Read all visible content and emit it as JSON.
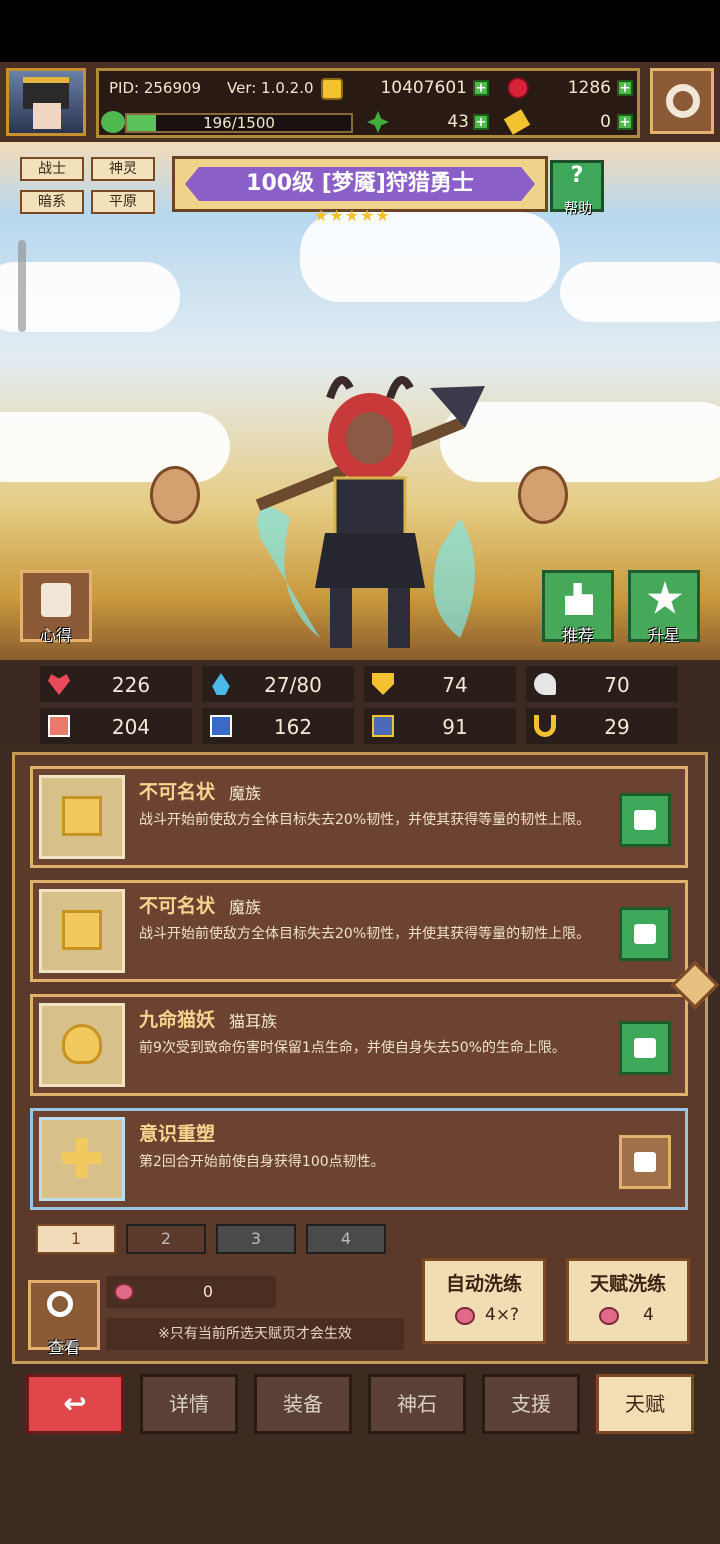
{
  "header": {
    "pid": "PID: 256909",
    "ver": "Ver: 1.0.2.0",
    "gold": "10407601",
    "gems": "1286",
    "exp": "196/1500",
    "clover": "43",
    "key": "0"
  },
  "hero": {
    "tags": [
      "战士",
      "神灵",
      "暗系",
      "平原"
    ],
    "name": "100级  [梦魇]狩猎勇士",
    "stars": "★★★★★",
    "help": "帮助"
  },
  "scene_buttons": {
    "insight": "心得",
    "recommend": "推荐",
    "upstar": "升星"
  },
  "stats": [
    {
      "icon": "heart-icon",
      "value": "226"
    },
    {
      "icon": "mana-drop-icon",
      "value": "27/80"
    },
    {
      "icon": "shield-icon",
      "value": "74"
    },
    {
      "icon": "wing-icon",
      "value": "70"
    },
    {
      "icon": "fist-icon",
      "value": "204"
    },
    {
      "icon": "book-icon",
      "value": "162"
    },
    {
      "icon": "armor-icon",
      "value": "91"
    },
    {
      "icon": "horseshoe-icon",
      "value": "29"
    }
  ],
  "talents": [
    {
      "name": "不可名状",
      "race": "魔族",
      "desc": "战斗开始前使敌方全体目标失去20%韧性，并使其获得等量的韧性上限。"
    },
    {
      "name": "不可名状",
      "race": "魔族",
      "desc": "战斗开始前使敌方全体目标失去20%韧性，并使其获得等量的韧性上限。"
    },
    {
      "name": "九命猫妖",
      "race": "猫耳族",
      "desc": "前9次受到致命伤害时保留1点生命，并使自身失去50%的生命上限。"
    },
    {
      "name": "意识重塑",
      "race": "",
      "desc": "第2回合开始前使自身获得100点韧性。"
    }
  ],
  "pages": [
    "1",
    "2",
    "3",
    "4"
  ],
  "bottom_panel": {
    "view": "查看",
    "peach_count": "0",
    "notice": "※只有当前所选天赋页才会生效",
    "auto_wash": "自动洗练",
    "auto_wash_cost": "4×?",
    "talent_wash": "天赋洗练",
    "talent_wash_cost": "4"
  },
  "nav": [
    "详情",
    "装备",
    "神石",
    "支援",
    "天赋"
  ]
}
